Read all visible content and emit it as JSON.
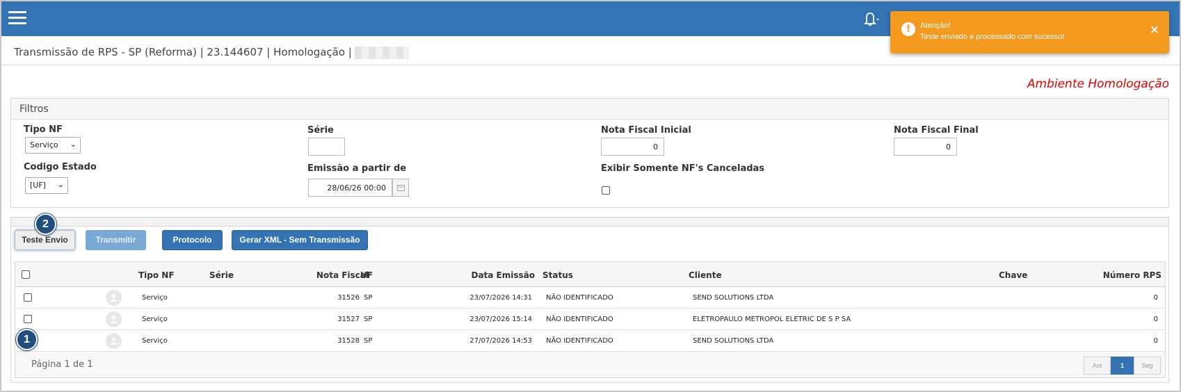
{
  "notification": {
    "title": "Atenção!",
    "message": "Teste enviado e processado com sucesso!",
    "close_icon": "×",
    "bg_color": "#f39a1e"
  },
  "header": {
    "bg_color": "#3373b4",
    "page_title": "Transmissão de RPS - SP (Reforma) | 23.144607 | Homologação |"
  },
  "environment_label": "Ambiente Homologação",
  "filters": {
    "panel_title": "Filtros",
    "tipo_nf": {
      "label": "Tipo NF",
      "value": "Serviço"
    },
    "serie": {
      "label": "Série",
      "value": ""
    },
    "nota_inicial": {
      "label": "Nota Fiscal Inicial",
      "value": "0"
    },
    "nota_final": {
      "label": "Nota Fiscal Final",
      "value": "0"
    },
    "codigo_estado": {
      "label": "Codigo Estado",
      "value": "[UF]"
    },
    "emissao": {
      "label": "Emissão a partir de",
      "value": "28/06/26 00:00"
    },
    "somente_canceladas": {
      "label": "Exibir Somente NF's Canceladas",
      "checked": false
    }
  },
  "actions": {
    "teste_envio": "Teste Envio",
    "transmitir": "Transmitir",
    "protocolo": "Protocolo",
    "gerar_xml": "Gerar XML - Sem Transmissão"
  },
  "callouts": {
    "one": "1",
    "two": "2"
  },
  "table": {
    "columns": {
      "tipo_nf": "Tipo NF",
      "serie": "Série",
      "nota_fiscal": "Nota Fiscal",
      "uf": "UF",
      "data_emissao": "Data Emissão",
      "status": "Status",
      "cliente": "Cliente",
      "chave": "Chave",
      "numero_rps": "Número RPS"
    },
    "rows": [
      {
        "tipo": "Serviço",
        "serie": "",
        "nota": "31526",
        "uf": "SP",
        "data": "23/07/2026 14:31",
        "status": "NÃO IDENTIFICADO",
        "cliente": "SEND SOLUTIONS LTDA",
        "chave": "",
        "rps": "0"
      },
      {
        "tipo": "Serviço",
        "serie": "",
        "nota": "31527",
        "uf": "SP",
        "data": "23/07/2026 15:14",
        "status": "NÃO IDENTIFICADO",
        "cliente": "ELETROPAULO METROPOL ELETRIC DE S P SA",
        "chave": "",
        "rps": "0"
      },
      {
        "tipo": "Serviço",
        "serie": "",
        "nota": "31528",
        "uf": "SP",
        "data": "27/07/2026 14:53",
        "status": "NÃO IDENTIFICADO",
        "cliente": "SEND SOLUTIONS LTDA",
        "chave": "",
        "rps": "0"
      }
    ]
  },
  "pager": {
    "summary": "Página 1 de 1",
    "prev": "Ant",
    "current": "1",
    "next": "Seg"
  }
}
